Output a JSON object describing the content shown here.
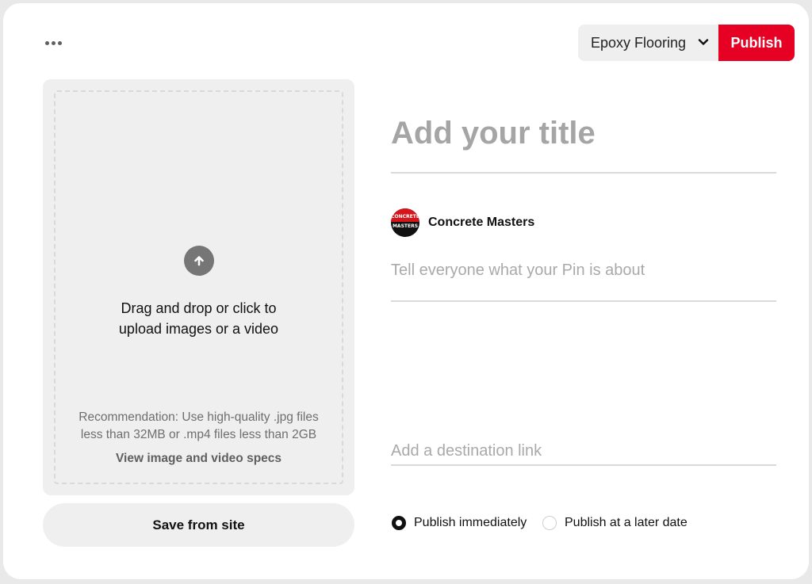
{
  "toolbar": {
    "more_icon": "ellipsis-icon",
    "board_selected": "Epoxy Flooring",
    "board_chevron_icon": "chevron-down-icon",
    "publish_label": "Publish",
    "publish_color": "#e60023"
  },
  "upload": {
    "icon": "arrow-up-circle-icon",
    "line1": "Drag and drop or click to",
    "line2": "upload images or a video",
    "recommendation_line1": "Recommendation: Use high-quality .jpg files",
    "recommendation_line2": "less than 32MB or .mp4 files less than 2GB",
    "specs_link": "View image and video specs"
  },
  "save_from_site_label": "Save from site",
  "form": {
    "title_placeholder": "Add your title",
    "title_value": "",
    "account": {
      "name": "Concrete Masters",
      "avatar_text_top": "CONCRETE",
      "avatar_text_bottom": "MASTERS"
    },
    "description_placeholder": "Tell everyone what your Pin is about",
    "description_value": "",
    "link_placeholder": "Add a destination link",
    "link_value": ""
  },
  "schedule": {
    "options": [
      {
        "label": "Publish immediately",
        "selected": true
      },
      {
        "label": "Publish at a later date",
        "selected": false
      }
    ]
  }
}
